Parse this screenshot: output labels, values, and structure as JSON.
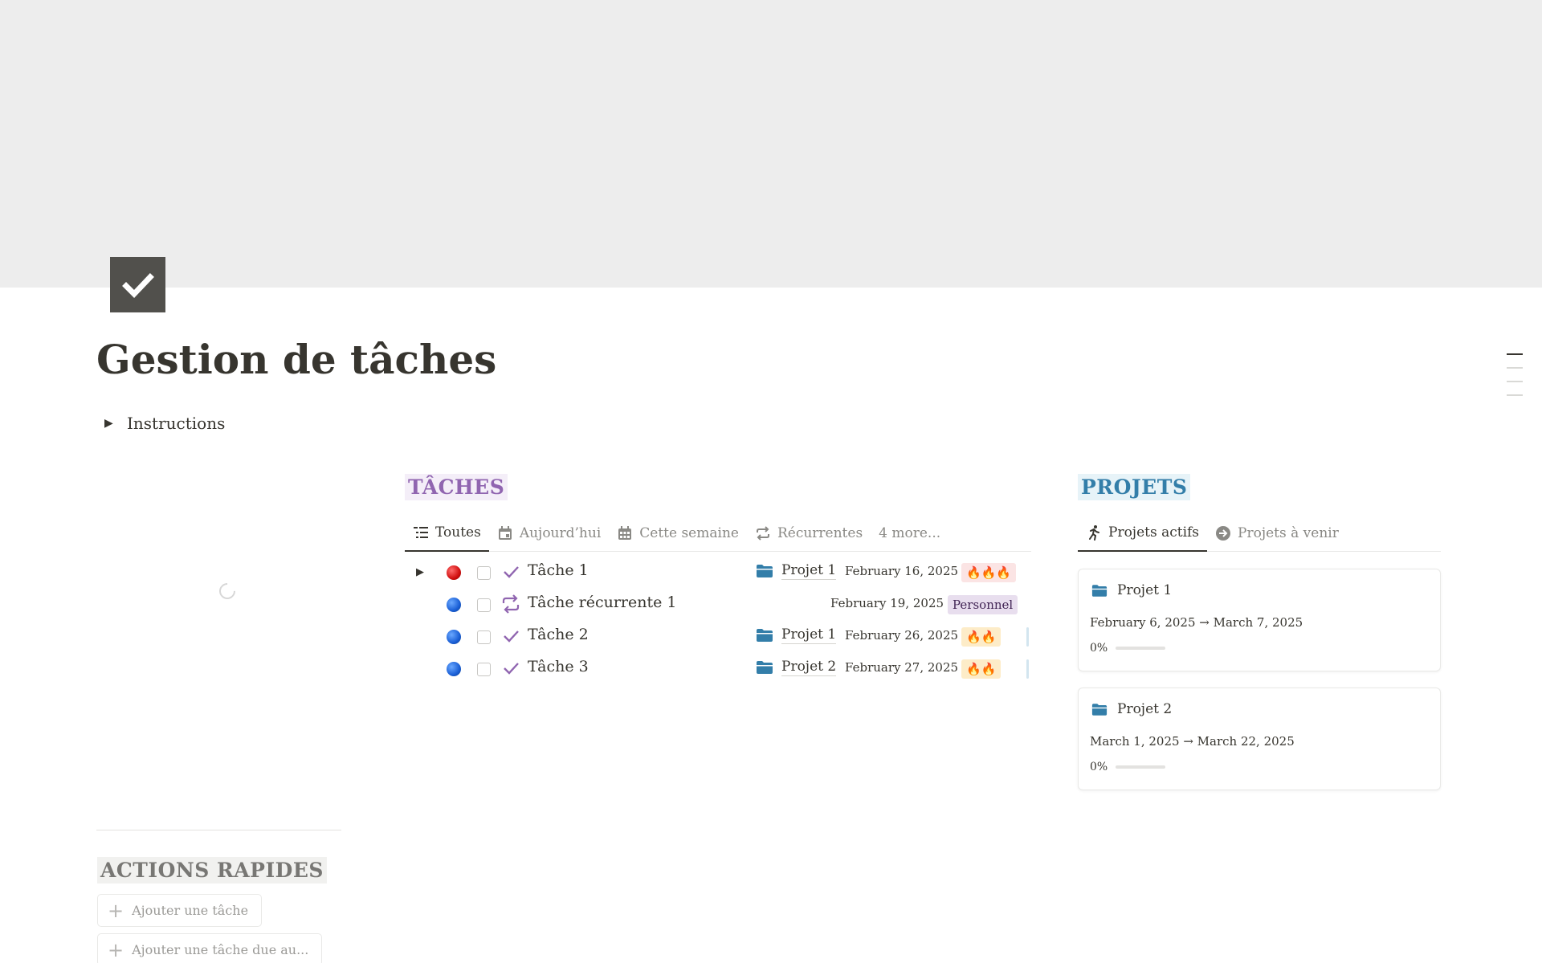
{
  "page": {
    "title": "Gestion de tâches",
    "icon": "checkbox-icon",
    "toggle_label": "Instructions"
  },
  "colors": {
    "tasks_accent": "#9065b0",
    "projects_accent": "#337ea9",
    "actions_accent": "#787774"
  },
  "tasks": {
    "heading": "TÂCHES",
    "tabs": [
      {
        "label": "Toutes",
        "icon": "list-icon",
        "active": true
      },
      {
        "label": "Aujourd’hui",
        "icon": "calendar-today-icon",
        "active": false
      },
      {
        "label": "Cette semaine",
        "icon": "calendar-week-icon",
        "active": false
      },
      {
        "label": "Récurrentes",
        "icon": "repeat-icon",
        "active": false
      },
      {
        "label": "4 more...",
        "icon": "",
        "active": false
      }
    ],
    "rows": [
      {
        "name": "Tâche 1",
        "kind": "check-icon",
        "dot": "red",
        "project": "Projet 1",
        "date": "February 16, 2025",
        "priority": "🔥🔥🔥"
      },
      {
        "name": "Tâche récurrente 1",
        "kind": "repeat-icon",
        "dot": "blue",
        "project": "",
        "date": "February 19, 2025",
        "priority": "Personnel"
      },
      {
        "name": "Tâche 2",
        "kind": "check-icon",
        "dot": "blue",
        "project": "Projet 1",
        "date": "February 26, 2025",
        "priority": "🔥🔥"
      },
      {
        "name": "Tâche 3",
        "kind": "check-icon",
        "dot": "blue",
        "project": "Projet 2",
        "date": "February 27, 2025",
        "priority": "🔥🔥"
      }
    ]
  },
  "projects": {
    "heading": "PROJETS",
    "tabs": [
      {
        "label": "Projets actifs",
        "icon": "running-person-icon",
        "active": true
      },
      {
        "label": "Projets à venir",
        "icon": "arrow-circle-icon",
        "active": false
      }
    ],
    "cards": [
      {
        "title": "Projet 1",
        "dates": "February 6, 2025 → March 7, 2025",
        "progress_label": "0%",
        "progress": 0
      },
      {
        "title": "Projet 2",
        "dates": "March 1, 2025 → March 22, 2025",
        "progress_label": "0%",
        "progress": 0
      }
    ]
  },
  "actions": {
    "heading": "ACTIONS RAPIDES",
    "buttons": [
      {
        "label": "Ajouter une tâche"
      },
      {
        "label": "Ajouter une tâche due au..."
      }
    ]
  }
}
